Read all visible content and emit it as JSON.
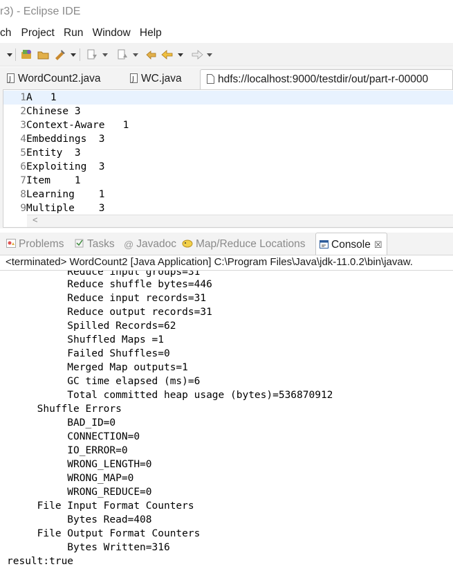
{
  "window": {
    "title": "r3) - Eclipse IDE"
  },
  "menubar": {
    "items": [
      "ch",
      "Project",
      "Run",
      "Window",
      "Help"
    ]
  },
  "toolbar": {
    "icons": [
      "dropdown-arrow-icon",
      "open-type-icon",
      "open-folder-icon",
      "run-tool-icon",
      "chevron-down-icon",
      "annotation-icon",
      "chevron-down-icon",
      "annotation-prev-icon",
      "chevron-down-icon",
      "last-edit-icon",
      "back-icon",
      "chevron-down-icon",
      "forward-icon",
      "chevron-down-icon"
    ]
  },
  "editor": {
    "tabs": [
      {
        "label": "WordCount2.java",
        "active": false
      },
      {
        "label": "WC.java",
        "active": false
      },
      {
        "label": "hdfs://localhost:9000/testdir/out/part-r-00000",
        "active": true
      }
    ],
    "lines": [
      {
        "num": "1",
        "text": "A   1"
      },
      {
        "num": "2",
        "text": "Chinese 3"
      },
      {
        "num": "3",
        "text": "Context-Aware   1"
      },
      {
        "num": "4",
        "text": "Embeddings  3"
      },
      {
        "num": "5",
        "text": "Entity  3"
      },
      {
        "num": "6",
        "text": "Exploiting  3"
      },
      {
        "num": "7",
        "text": "Item    1"
      },
      {
        "num": "8",
        "text": "Learning    1"
      },
      {
        "num": "9",
        "text": "Multiple    3"
      }
    ],
    "scroll_arrow": "<"
  },
  "views": {
    "tabs": [
      {
        "label": "Problems"
      },
      {
        "label": "Tasks"
      },
      {
        "label": "Javadoc"
      },
      {
        "label": "Map/Reduce Locations"
      },
      {
        "label": "Console",
        "active": true
      }
    ],
    "close_glyph": "☒"
  },
  "console": {
    "header": "<terminated> WordCount2 [Java Application] C:\\Program Files\\Java\\jdk-11.0.2\\bin\\javaw.",
    "lines": [
      "          Reduce input groups=31",
      "          Reduce shuffle bytes=446",
      "          Reduce input records=31",
      "          Reduce output records=31",
      "          Spilled Records=62",
      "          Shuffled Maps =1",
      "          Failed Shuffles=0",
      "          Merged Map outputs=1",
      "          GC time elapsed (ms)=6",
      "          Total committed heap usage (bytes)=536870912",
      "     Shuffle Errors",
      "          BAD_ID=0",
      "          CONNECTION=0",
      "          IO_ERROR=0",
      "          WRONG_LENGTH=0",
      "          WRONG_MAP=0",
      "          WRONG_REDUCE=0",
      "     File Input Format Counters",
      "          Bytes Read=408",
      "     File Output Format Counters",
      "          Bytes Written=316",
      "result:true"
    ]
  },
  "colors": {
    "current_line": "#e8f2fe",
    "tab_bg": "#f3f3f3",
    "muted_text": "#8a8a8a"
  }
}
